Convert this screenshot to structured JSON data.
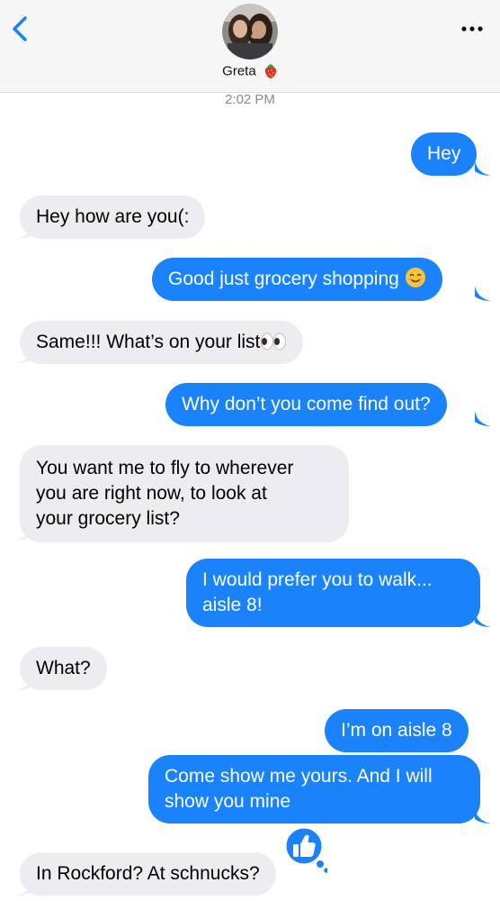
{
  "header": {
    "contact_name": "Greta",
    "name_emoji_icon": "strawberry-icon",
    "back_icon": "chevron-left-icon",
    "more_icon": "ellipsis-icon"
  },
  "timestamp": "2:02 PM",
  "messages": [
    {
      "direction": "sent",
      "text": "Hey"
    },
    {
      "direction": "received",
      "text": "Hey how are you(:"
    },
    {
      "direction": "sent",
      "text": "Good just grocery shopping",
      "emoji_icon": "smiling-face-icon"
    },
    {
      "direction": "received",
      "text": "Same!!! What’s on your list",
      "emoji_icon": "eyes-icon"
    },
    {
      "direction": "sent",
      "text": "Why don’t you come find out?"
    },
    {
      "direction": "received",
      "lines": [
        "You want me to fly to wherever",
        "you are right now, to look at",
        "your grocery list?"
      ]
    },
    {
      "direction": "sent",
      "lines": [
        "I would prefer you to walk...",
        "aisle 8!"
      ]
    },
    {
      "direction": "received",
      "text": "What?"
    },
    {
      "direction": "sent",
      "text": "I’m on aisle 8"
    },
    {
      "direction": "sent",
      "lines": [
        "Come show me yours. And I will",
        "show you mine"
      ],
      "reaction_icon": "thumbs-up-icon"
    },
    {
      "direction": "received",
      "text": "In Rockford? At schnucks?"
    }
  ],
  "colors": {
    "sent_bubble": "#1a82fb",
    "received_bubble": "#ececf1",
    "accent": "#1a82fb",
    "header_bg": "#f6f6f6"
  }
}
